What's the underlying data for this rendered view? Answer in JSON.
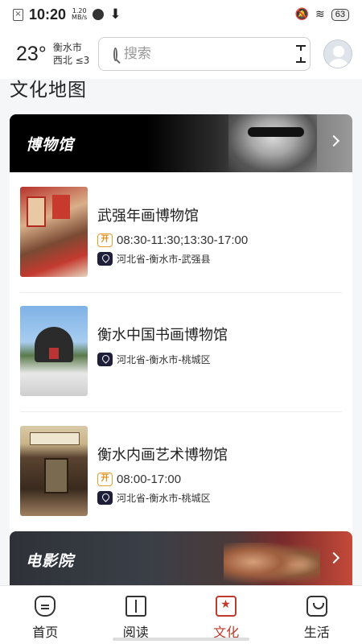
{
  "status_bar": {
    "time": "10:20",
    "speed_value": "1.20",
    "speed_unit": "MB/s",
    "battery": "63"
  },
  "header": {
    "temperature": "23°",
    "city": "衡水市",
    "wind": "西北 ≤3",
    "search_placeholder": "搜索"
  },
  "section_title": "文化地图",
  "museum_banner": {
    "title": "博物馆"
  },
  "museums": [
    {
      "name": "武强年画博物馆",
      "hours": "08:30-11:30;13:30-17:00",
      "address": "河北省-衡水市-武强县",
      "open_icon": "开"
    },
    {
      "name": "衡水中国书画博物馆",
      "address": "河北省-衡水市-桃城区"
    },
    {
      "name": "衡水内画艺术博物馆",
      "hours": "08:00-17:00",
      "address": "河北省-衡水市-桃城区",
      "open_icon": "开"
    }
  ],
  "cinema_banner": {
    "title": "电影院"
  },
  "bottom_nav": [
    {
      "label": "首页",
      "icon": "home-icon"
    },
    {
      "label": "阅读",
      "icon": "book-icon"
    },
    {
      "label": "文化",
      "icon": "culture-icon",
      "active": true
    },
    {
      "label": "生活",
      "icon": "life-icon"
    }
  ],
  "colors": {
    "accent": "#c0392b",
    "open_icon": "#e89a2a",
    "location_icon": "#1f1f3a"
  }
}
